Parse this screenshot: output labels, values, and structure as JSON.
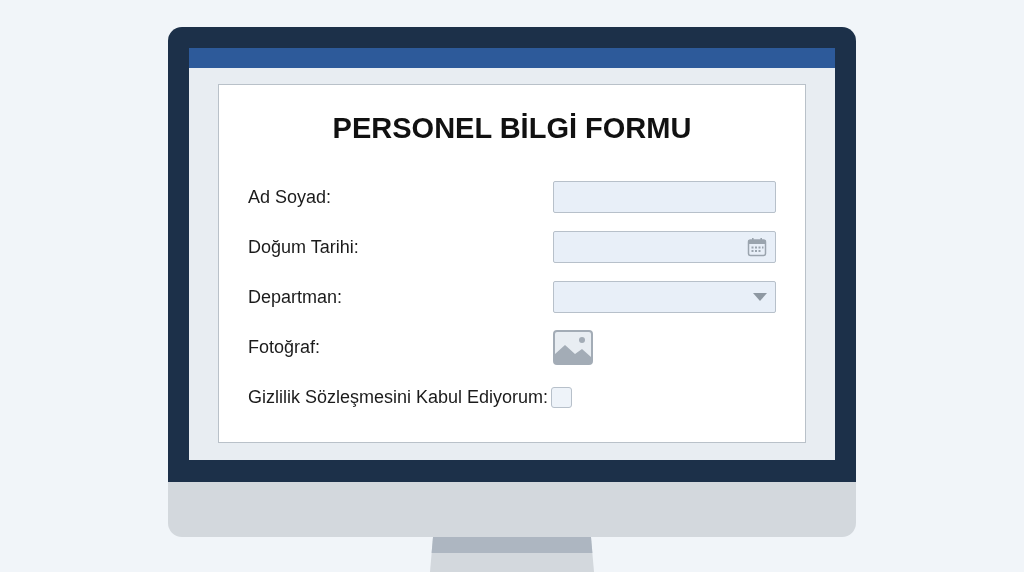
{
  "form": {
    "title": "PERSONEL BİLGİ FORMU",
    "fields": [
      {
        "kind": "text",
        "label": "Ad Soyad:"
      },
      {
        "kind": "date",
        "label": "Doğum Tarihi:"
      },
      {
        "kind": "select",
        "label": "Departman:"
      },
      {
        "kind": "photo",
        "label": "Fotoğraf:"
      },
      {
        "kind": "checkbox",
        "label": "Gizlilik Sözleşmesini Kabul Ediyorum:",
        "checked": false
      }
    ]
  }
}
